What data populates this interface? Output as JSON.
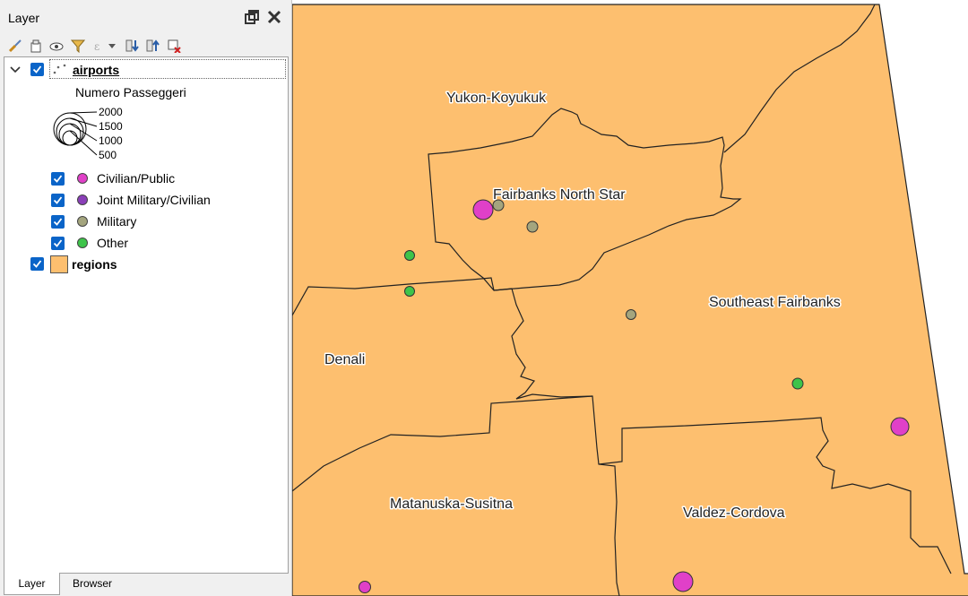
{
  "panel": {
    "title": "Layer",
    "icons": {
      "float": "float-panel-icon",
      "close": "close-icon",
      "toolbar": [
        "style-brush-icon",
        "add-group-icon",
        "eye-visibility-icon",
        "filter-icon",
        "expression-filter-icon",
        "dropdown-arrow-icon",
        "expand-all-icon",
        "collapse-all-icon",
        "remove-layer-icon"
      ]
    }
  },
  "layers": {
    "airports": {
      "name": "airports",
      "size_legend": {
        "title": "Numero Passeggeri",
        "values": [
          "2000",
          "1500",
          "1000",
          "500"
        ]
      },
      "categories": [
        {
          "label": "Civilian/Public",
          "color": "#e040c8"
        },
        {
          "label": "Joint Military/Civilian",
          "color": "#8a3fb8"
        },
        {
          "label": "Military",
          "color": "#a4a57e"
        },
        {
          "label": "Other",
          "color": "#3ec44a"
        }
      ]
    },
    "regions": {
      "name": "regions",
      "color": "#fdbf6f"
    }
  },
  "tabs": {
    "layer": "Layer",
    "browser": "Browser"
  },
  "map": {
    "fill_color": "#fdbf6f",
    "labels": {
      "yukon": "Yukon-Koyukuk",
      "fairbanks": "Fairbanks North Star",
      "southeast": "Southeast Fairbanks",
      "denali": "Denali",
      "matanuska": "Matanuska-Susitna",
      "valdez": "Valdez-Cordova"
    }
  }
}
